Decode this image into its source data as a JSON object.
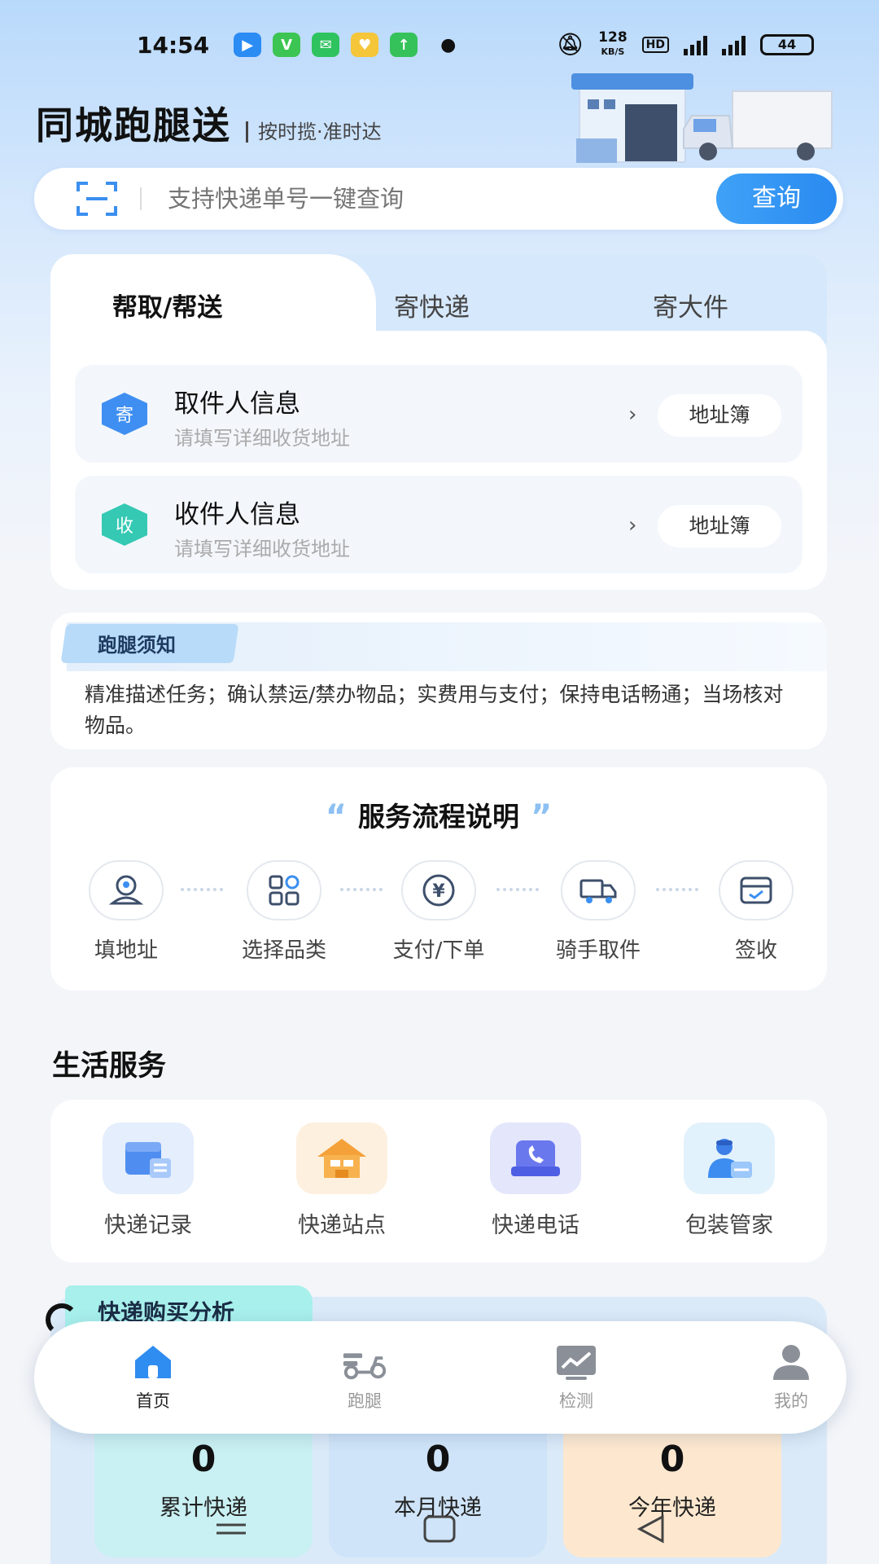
{
  "status_bar": {
    "time": "14:54",
    "app_icons": [
      "bilibili-icon",
      "vivo-icon",
      "wechat-icon",
      "weixin-icon",
      "upload-icon"
    ],
    "net_speed": "128",
    "net_unit": "KB/S",
    "hd": "HD",
    "battery": "44"
  },
  "header": {
    "title": "同城跑腿送",
    "slogan": "按时揽·准时达"
  },
  "search": {
    "placeholder": "支持快递单号一键查询",
    "button": "查询"
  },
  "send_tabs": [
    {
      "label": "帮取/帮送",
      "active": true
    },
    {
      "label": "寄快递",
      "active": false
    },
    {
      "label": "寄大件",
      "active": false
    }
  ],
  "address_rows": [
    {
      "badge": "寄",
      "title": "取件人信息",
      "hint": "请填写详细收货地址",
      "book": "地址簿",
      "color": "#3f8ff2"
    },
    {
      "badge": "收",
      "title": "收件人信息",
      "hint": "请填写详细收货地址",
      "book": "地址簿",
      "color": "#35c9b4"
    }
  ],
  "notice": {
    "label": "跑腿须知",
    "text": "精准描述任务；确认禁运/禁办物品；实费用与支付；保持电话畅通；当场核对物品。"
  },
  "flow": {
    "title": "服务流程说明",
    "steps": [
      {
        "label": "填地址",
        "icon": "location-user-icon"
      },
      {
        "label": "选择品类",
        "icon": "category-grid-icon"
      },
      {
        "label": "支付/下单",
        "icon": "yuan-payment-icon"
      },
      {
        "label": "骑手取件",
        "icon": "delivery-truck-icon"
      },
      {
        "label": "签收",
        "icon": "sign-box-icon"
      }
    ]
  },
  "life_services": {
    "title": "生活服务",
    "items": [
      {
        "label": "快递记录",
        "icon": "parcel-record-icon",
        "bg": "#e4eefc"
      },
      {
        "label": "快递站点",
        "icon": "station-house-icon",
        "bg": "#fdf0df"
      },
      {
        "label": "快递电话",
        "icon": "phone-icon",
        "bg": "#e4e6fb"
      },
      {
        "label": "包装管家",
        "icon": "courier-manager-icon",
        "bg": "#e2f2fc"
      }
    ]
  },
  "analysis": {
    "title": "快递购买分析",
    "stats": [
      {
        "value": "0",
        "label": "累计快递",
        "bg": "#c9f0f2"
      },
      {
        "value": "0",
        "label": "本月快递",
        "bg": "#cfe4f8"
      },
      {
        "value": "0",
        "label": "今年快递",
        "bg": "#fde8cf"
      }
    ]
  },
  "tabbar": [
    {
      "label": "首页",
      "icon": "home-icon",
      "active": true
    },
    {
      "label": "跑腿",
      "icon": "scooter-icon",
      "active": false
    },
    {
      "label": "检测",
      "icon": "chart-monitor-icon",
      "active": false
    },
    {
      "label": "我的",
      "icon": "user-icon",
      "active": false
    }
  ],
  "colors": {
    "accent": "#2a8af0",
    "background": "#f3f5f9"
  }
}
